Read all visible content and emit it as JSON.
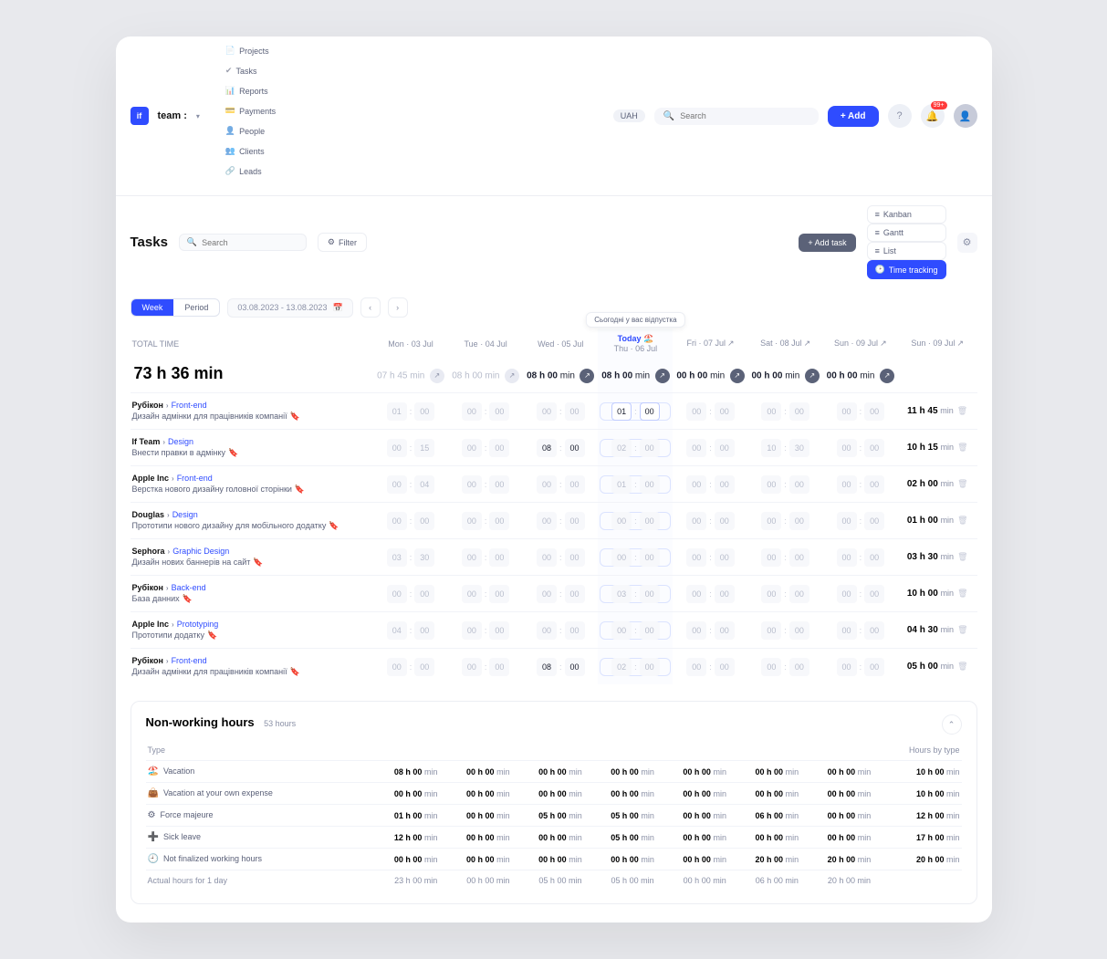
{
  "brand": {
    "logo": "if",
    "name": "team :"
  },
  "nav": [
    {
      "icon": "📄",
      "label": "Projects"
    },
    {
      "icon": "✔",
      "label": "Tasks"
    },
    {
      "icon": "📊",
      "label": "Reports"
    },
    {
      "icon": "💳",
      "label": "Payments"
    },
    {
      "icon": "👤",
      "label": "People"
    },
    {
      "icon": "👥",
      "label": "Clients"
    },
    {
      "icon": "🔗",
      "label": "Leads"
    }
  ],
  "currency": "UAH",
  "search_placeholder": "Search",
  "add_button": "+ Add",
  "notif_count": "99+",
  "subbar": {
    "title": "Tasks",
    "search_placeholder": "Search",
    "filter": "Filter",
    "add_task": "+ Add task",
    "views": [
      {
        "label": "Kanban"
      },
      {
        "label": "Gantt"
      },
      {
        "label": "List"
      },
      {
        "label": "Time tracking",
        "active": true
      }
    ]
  },
  "range": {
    "seg": [
      "Week",
      "Period"
    ],
    "value": "03.08.2023 - 13.08.2023"
  },
  "total_label": "TOTAL TIME",
  "total_value": "73 h 36 min",
  "tooltip": "Сьогодні у вас відпустка",
  "days": [
    {
      "label": "Mon · 03 Jul",
      "sum": "07 h 45 min",
      "dim": true
    },
    {
      "label": "Tue · 04 Jul",
      "sum": "08 h 00 min",
      "dim": true
    },
    {
      "label": "Wed · 05 Jul",
      "sum": "08 h 00 min",
      "dark": true
    },
    {
      "label": "Thu · 06 Jul",
      "today": "Today",
      "sum": "08 h 00 min",
      "dark": true,
      "is_today": true
    },
    {
      "label": "Fri · 07 Jul",
      "sum": "00 h 00 min",
      "dark": true
    },
    {
      "label": "Sat · 08 Jul",
      "sum": "00 h 00 min",
      "dark": true
    },
    {
      "label": "Sun · 09 Jul",
      "sum": "00 h 00 min",
      "dark": true
    },
    {
      "label": "Sun · 09 Jul",
      "no_sum": true
    }
  ],
  "tasks": [
    {
      "project": "Рубікон",
      "category": "Front-end",
      "title": "Дизайн адмінки для працівників компанії",
      "bk": "red",
      "cells": [
        [
          "01",
          "00"
        ],
        [
          "00",
          "00"
        ],
        [
          "00",
          "00"
        ],
        [
          "01",
          "00",
          "input"
        ],
        [
          "00",
          "00"
        ],
        [
          "00",
          "00"
        ],
        [
          "00",
          "00"
        ]
      ],
      "total": "11 h 45 min"
    },
    {
      "project": "If Team",
      "category": "Design",
      "title": "Внести правки в адмінку",
      "bk": "red",
      "cells": [
        [
          "00",
          "15"
        ],
        [
          "00",
          "00"
        ],
        [
          "08",
          "00",
          "dark"
        ],
        [
          "02",
          "00"
        ],
        [
          "00",
          "00"
        ],
        [
          "10",
          "30"
        ],
        [
          "00",
          "00"
        ]
      ],
      "total": "10 h 15 min"
    },
    {
      "project": "Apple Inc",
      "category": "Front-end",
      "title": "Верстка нового дизайну головної сторінки",
      "bk": "red",
      "cells": [
        [
          "00",
          "04"
        ],
        [
          "00",
          "00"
        ],
        [
          "00",
          "00"
        ],
        [
          "01",
          "00"
        ],
        [
          "00",
          "00"
        ],
        [
          "00",
          "00"
        ],
        [
          "00",
          "00"
        ]
      ],
      "total": "02 h 00 min"
    },
    {
      "project": "Douglas",
      "category": "Design",
      "title": "Прототипи нового дизайну для мобільного додатку",
      "bk": "orange",
      "cells": [
        [
          "00",
          "00"
        ],
        [
          "00",
          "00"
        ],
        [
          "00",
          "00"
        ],
        [
          "00",
          "00"
        ],
        [
          "00",
          "00"
        ],
        [
          "00",
          "00"
        ],
        [
          "00",
          "00"
        ]
      ],
      "total": "01 h 00 min"
    },
    {
      "project": "Sephora",
      "category": "Graphic Design",
      "title": "Дизайн нових баннерів на сайт",
      "bk": "orange",
      "cells": [
        [
          "03",
          "30"
        ],
        [
          "00",
          "00"
        ],
        [
          "00",
          "00"
        ],
        [
          "00",
          "00"
        ],
        [
          "00",
          "00"
        ],
        [
          "00",
          "00"
        ],
        [
          "00",
          "00"
        ]
      ],
      "total": "03 h 30 min"
    },
    {
      "project": "Рубікон",
      "category": "Back-end",
      "title": "База данних",
      "bk": "orange",
      "cells": [
        [
          "00",
          "00"
        ],
        [
          "00",
          "00"
        ],
        [
          "00",
          "00"
        ],
        [
          "03",
          "00"
        ],
        [
          "00",
          "00"
        ],
        [
          "00",
          "00"
        ],
        [
          "00",
          "00"
        ]
      ],
      "total": "10 h 00 min"
    },
    {
      "project": "Apple Inc",
      "category": "Prototyping",
      "title": "Прототипи додатку",
      "bk": "blue",
      "cells": [
        [
          "04",
          "00"
        ],
        [
          "00",
          "00"
        ],
        [
          "00",
          "00"
        ],
        [
          "00",
          "00"
        ],
        [
          "00",
          "00"
        ],
        [
          "00",
          "00"
        ],
        [
          "00",
          "00"
        ]
      ],
      "total": "04 h 30 min"
    },
    {
      "project": "Рубікон",
      "category": "Front-end",
      "title": "Дизайн адмінки для працівників компанії",
      "bk": "blue",
      "cells": [
        [
          "00",
          "00"
        ],
        [
          "00",
          "00"
        ],
        [
          "08",
          "00",
          "dark"
        ],
        [
          "02",
          "00"
        ],
        [
          "00",
          "00"
        ],
        [
          "00",
          "00"
        ],
        [
          "00",
          "00"
        ]
      ],
      "total": "05 h 00 min"
    }
  ],
  "nonwork": {
    "title": "Non-working hours",
    "subtitle": "53 hours",
    "type_header": "Type",
    "total_header": "Hours by type",
    "rows": [
      {
        "emoji": "🏖️",
        "label": "Vacation",
        "v": [
          "08 h 00",
          "00 h 00",
          "00 h 00",
          "00 h 00",
          "00 h 00",
          "00 h 00",
          "00 h 00"
        ],
        "total": "10 h 00"
      },
      {
        "emoji": "👜",
        "label": "Vacation at your own expense",
        "v": [
          "00 h 00",
          "00 h 00",
          "00 h 00",
          "00 h 00",
          "00 h 00",
          "00 h 00",
          "00 h 00"
        ],
        "total": "10 h 00"
      },
      {
        "emoji": "⚙",
        "label": "Force majeure",
        "v": [
          "01 h 00",
          "00 h 00",
          "05 h 00",
          "05 h 00",
          "00 h 00",
          "06 h 00",
          "00 h 00"
        ],
        "total": "12 h 00"
      },
      {
        "emoji": "➕",
        "label": "Sick leave",
        "v": [
          "12 h 00",
          "00 h 00",
          "00 h 00",
          "05 h 00",
          "00 h 00",
          "00 h 00",
          "00 h 00"
        ],
        "total": "17 h 00"
      },
      {
        "emoji": "🕘",
        "label": "Not finalized working hours",
        "v": [
          "00 h 00",
          "00 h 00",
          "00 h 00",
          "00 h 00",
          "00 h 00",
          "20 h 00",
          "20 h 00"
        ],
        "total": "20 h 00"
      }
    ],
    "actual": {
      "label": "Actual hours for 1 day",
      "v": [
        "23 h 00",
        "00 h 00",
        "05 h 00",
        "05 h 00",
        "00 h 00",
        "06 h 00",
        "20 h 00"
      ]
    }
  }
}
